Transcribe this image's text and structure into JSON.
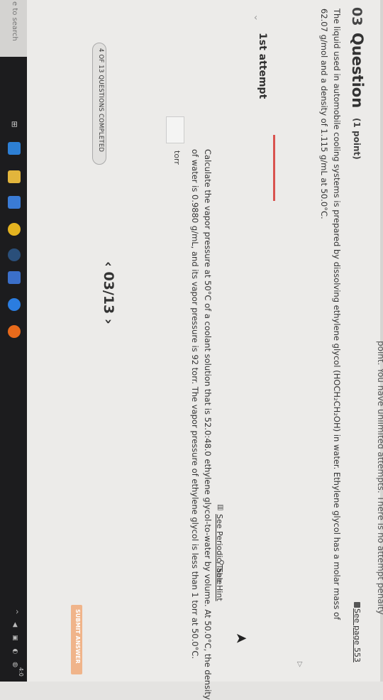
{
  "header": {
    "penalty_text": "point. You have unlimited attempts. There is no attempt penalty"
  },
  "question": {
    "number": "03",
    "title": "Question",
    "points": "(1 point)",
    "see_page": "See page 553",
    "stem_line1": "The liquid used in automobile cooling systems is prepared by dissolving ethylene glycol (HOCH₂CH₂OH) in water. Ethylene glycol has a molar mass of",
    "stem_line2": "62.07 g/mol and a density of 1.115 g/mL at 50.0°C."
  },
  "attempt": {
    "label": "1st attempt",
    "see_periodic": "See Periodic Table",
    "see_hint": "See Hint",
    "problem_line1": "Calculate the vapor pressure at 50°C of a coolant solution that is 52.0:48.0 ethylene glycol-to-water by volume. At 50.0°C, the density",
    "problem_line2": "of water is 0.9880 g/mL, and its vapor pressure is 92 torr. The vapor pressure of ethylene glycol is less than 1 torr at 50.0°C.",
    "answer_value": "",
    "unit": "torr"
  },
  "footer": {
    "status": "4 OF 13 QUESTIONS COMPLETED",
    "pager": "03/13",
    "submit": "SUBMIT ANSWER"
  },
  "taskbar": {
    "search_text": "e to search",
    "task_view_glyph": "⊞",
    "tray_glyphs": "^ ◀ ▣ ◐ ◍",
    "clock": "4:0"
  },
  "colors": {
    "accent_red": "#d9534f",
    "submit_orange": "#f0b48a",
    "taskbar": "#1c1c1e"
  }
}
